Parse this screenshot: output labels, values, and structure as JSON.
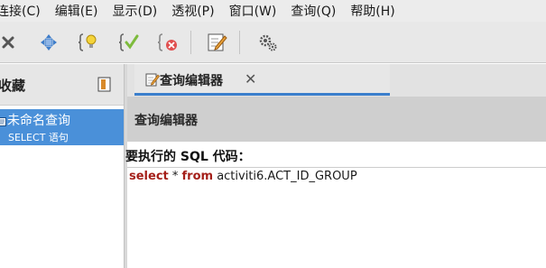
{
  "menubar": {
    "items": [
      "连接(C)",
      "编辑(E)",
      "显示(D)",
      "透视(P)",
      "窗口(W)",
      "查询(Q)",
      "帮助(H)"
    ]
  },
  "toolbar": {
    "buttons": [
      "close-icon",
      "move-icon",
      "bulb-brace-icon",
      "check-brace-icon",
      "delete-brace-icon",
      "edit-note-icon",
      "settings-gears-icon"
    ]
  },
  "favorites": {
    "title": "收藏",
    "items": [
      {
        "name": "未命名查询",
        "type": "SELECT 语句"
      }
    ]
  },
  "tabs": [
    {
      "label": "查询编辑器",
      "close": "✕"
    }
  ],
  "editor": {
    "title": "查询编辑器",
    "prompt": "要执行的 SQL 代码：",
    "code": {
      "kw_select": "select",
      "star": " * ",
      "kw_from": "from",
      "table": " activiti6.ACT_ID_GROUP"
    }
  },
  "colors": {
    "accent": "#4a90d9",
    "keyword": "#a5201a"
  }
}
